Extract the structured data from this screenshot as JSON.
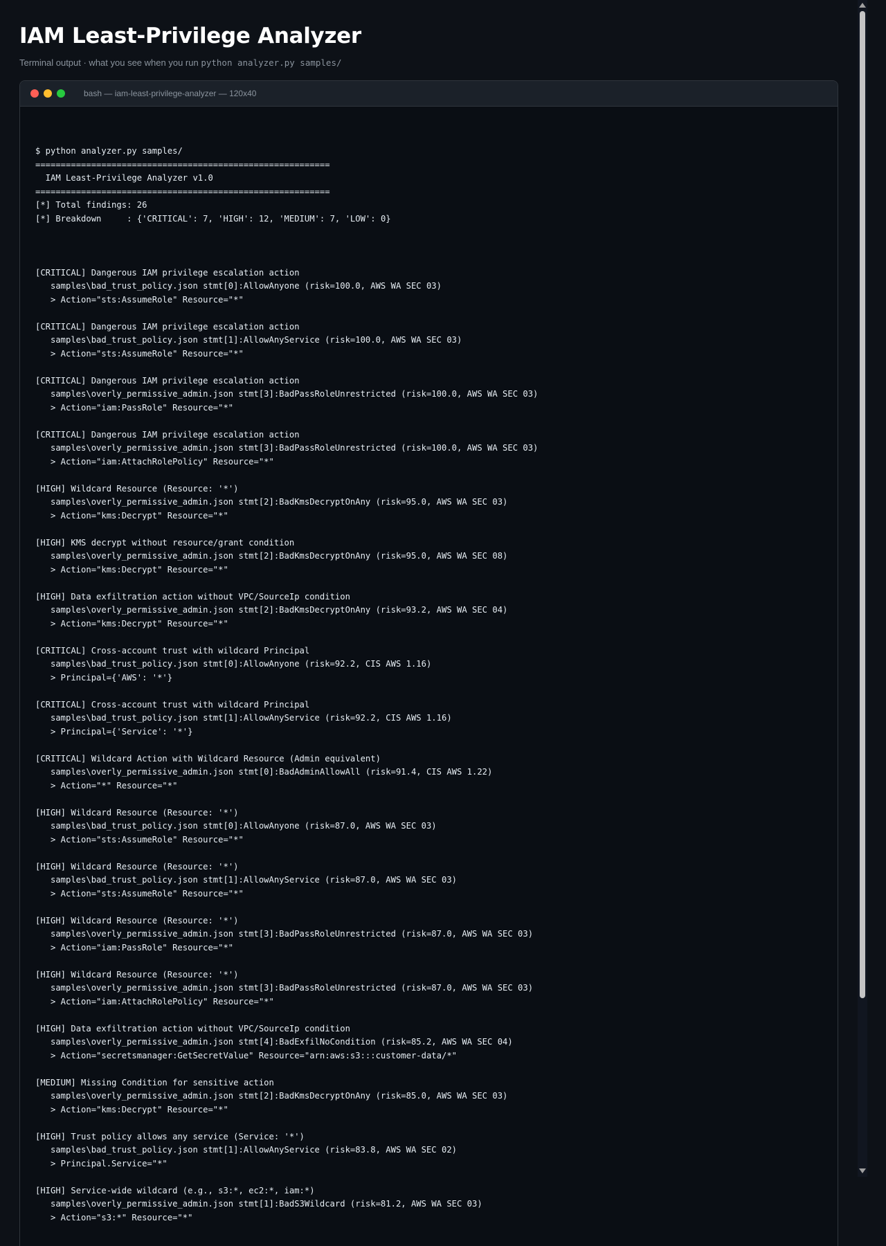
{
  "page": {
    "title": "IAM Least-Privilege Analyzer",
    "subtitle_prefix": "Terminal output · what you see when you run ",
    "subtitle_command": "python analyzer.py samples/"
  },
  "terminal": {
    "title": "bash — iam-least-privilege-analyzer — 120x40",
    "buttons": {
      "close": "#ff5f56",
      "minimize": "#ffbd2e",
      "maximize": "#27c93f"
    },
    "header_lines": [
      "$ python analyzer.py samples/",
      "==========================================================",
      "  IAM Least-Privilege Analyzer v1.0",
      "==========================================================",
      "[*] Total findings: 26",
      "[*] Breakdown     : {'CRITICAL': 7, 'HIGH': 12, 'MEDIUM': 7, 'LOW': 0}"
    ],
    "findings": [
      {
        "headline": "[CRITICAL] Dangerous IAM privilege escalation action",
        "location": "samples\\bad_trust_policy.json stmt[0]:AllowAnyone (risk=100.0, AWS WA SEC 03)",
        "evidence": "> Action=\"sts:AssumeRole\" Resource=\"*\""
      },
      {
        "headline": "[CRITICAL] Dangerous IAM privilege escalation action",
        "location": "samples\\bad_trust_policy.json stmt[1]:AllowAnyService (risk=100.0, AWS WA SEC 03)",
        "evidence": "> Action=\"sts:AssumeRole\" Resource=\"*\""
      },
      {
        "headline": "[CRITICAL] Dangerous IAM privilege escalation action",
        "location": "samples\\overly_permissive_admin.json stmt[3]:BadPassRoleUnrestricted (risk=100.0, AWS WA SEC 03)",
        "evidence": "> Action=\"iam:PassRole\" Resource=\"*\""
      },
      {
        "headline": "[CRITICAL] Dangerous IAM privilege escalation action",
        "location": "samples\\overly_permissive_admin.json stmt[3]:BadPassRoleUnrestricted (risk=100.0, AWS WA SEC 03)",
        "evidence": "> Action=\"iam:AttachRolePolicy\" Resource=\"*\""
      },
      {
        "headline": "[HIGH] Wildcard Resource (Resource: '*')",
        "location": "samples\\overly_permissive_admin.json stmt[2]:BadKmsDecryptOnAny (risk=95.0, AWS WA SEC 03)",
        "evidence": "> Action=\"kms:Decrypt\" Resource=\"*\""
      },
      {
        "headline": "[HIGH] KMS decrypt without resource/grant condition",
        "location": "samples\\overly_permissive_admin.json stmt[2]:BadKmsDecryptOnAny (risk=95.0, AWS WA SEC 08)",
        "evidence": "> Action=\"kms:Decrypt\" Resource=\"*\""
      },
      {
        "headline": "[HIGH] Data exfiltration action without VPC/SourceIp condition",
        "location": "samples\\overly_permissive_admin.json stmt[2]:BadKmsDecryptOnAny (risk=93.2, AWS WA SEC 04)",
        "evidence": "> Action=\"kms:Decrypt\" Resource=\"*\""
      },
      {
        "headline": "[CRITICAL] Cross-account trust with wildcard Principal",
        "location": "samples\\bad_trust_policy.json stmt[0]:AllowAnyone (risk=92.2, CIS AWS 1.16)",
        "evidence": "> Principal={'AWS': '*'}"
      },
      {
        "headline": "[CRITICAL] Cross-account trust with wildcard Principal",
        "location": "samples\\bad_trust_policy.json stmt[1]:AllowAnyService (risk=92.2, CIS AWS 1.16)",
        "evidence": "> Principal={'Service': '*'}"
      },
      {
        "headline": "[CRITICAL] Wildcard Action with Wildcard Resource (Admin equivalent)",
        "location": "samples\\overly_permissive_admin.json stmt[0]:BadAdminAllowAll (risk=91.4, CIS AWS 1.22)",
        "evidence": "> Action=\"*\" Resource=\"*\""
      },
      {
        "headline": "[HIGH] Wildcard Resource (Resource: '*')",
        "location": "samples\\bad_trust_policy.json stmt[0]:AllowAnyone (risk=87.0, AWS WA SEC 03)",
        "evidence": "> Action=\"sts:AssumeRole\" Resource=\"*\""
      },
      {
        "headline": "[HIGH] Wildcard Resource (Resource: '*')",
        "location": "samples\\bad_trust_policy.json stmt[1]:AllowAnyService (risk=87.0, AWS WA SEC 03)",
        "evidence": "> Action=\"sts:AssumeRole\" Resource=\"*\""
      },
      {
        "headline": "[HIGH] Wildcard Resource (Resource: '*')",
        "location": "samples\\overly_permissive_admin.json stmt[3]:BadPassRoleUnrestricted (risk=87.0, AWS WA SEC 03)",
        "evidence": "> Action=\"iam:PassRole\" Resource=\"*\""
      },
      {
        "headline": "[HIGH] Wildcard Resource (Resource: '*')",
        "location": "samples\\overly_permissive_admin.json stmt[3]:BadPassRoleUnrestricted (risk=87.0, AWS WA SEC 03)",
        "evidence": "> Action=\"iam:AttachRolePolicy\" Resource=\"*\""
      },
      {
        "headline": "[HIGH] Data exfiltration action without VPC/SourceIp condition",
        "location": "samples\\overly_permissive_admin.json stmt[4]:BadExfilNoCondition (risk=85.2, AWS WA SEC 04)",
        "evidence": "> Action=\"secretsmanager:GetSecretValue\" Resource=\"arn:aws:s3:::customer-data/*\""
      },
      {
        "headline": "[MEDIUM] Missing Condition for sensitive action",
        "location": "samples\\overly_permissive_admin.json stmt[2]:BadKmsDecryptOnAny (risk=85.0, AWS WA SEC 03)",
        "evidence": "> Action=\"kms:Decrypt\" Resource=\"*\""
      },
      {
        "headline": "[HIGH] Trust policy allows any service (Service: '*')",
        "location": "samples\\bad_trust_policy.json stmt[1]:AllowAnyService (risk=83.8, AWS WA SEC 02)",
        "evidence": "> Principal.Service=\"*\""
      },
      {
        "headline": "[HIGH] Service-wide wildcard (e.g., s3:*, ec2:*, iam:*)",
        "location": "samples\\overly_permissive_admin.json stmt[1]:BadS3Wildcard (risk=81.2, AWS WA SEC 03)",
        "evidence": "> Action=\"s3:*\" Resource=\"*\""
      }
    ]
  }
}
